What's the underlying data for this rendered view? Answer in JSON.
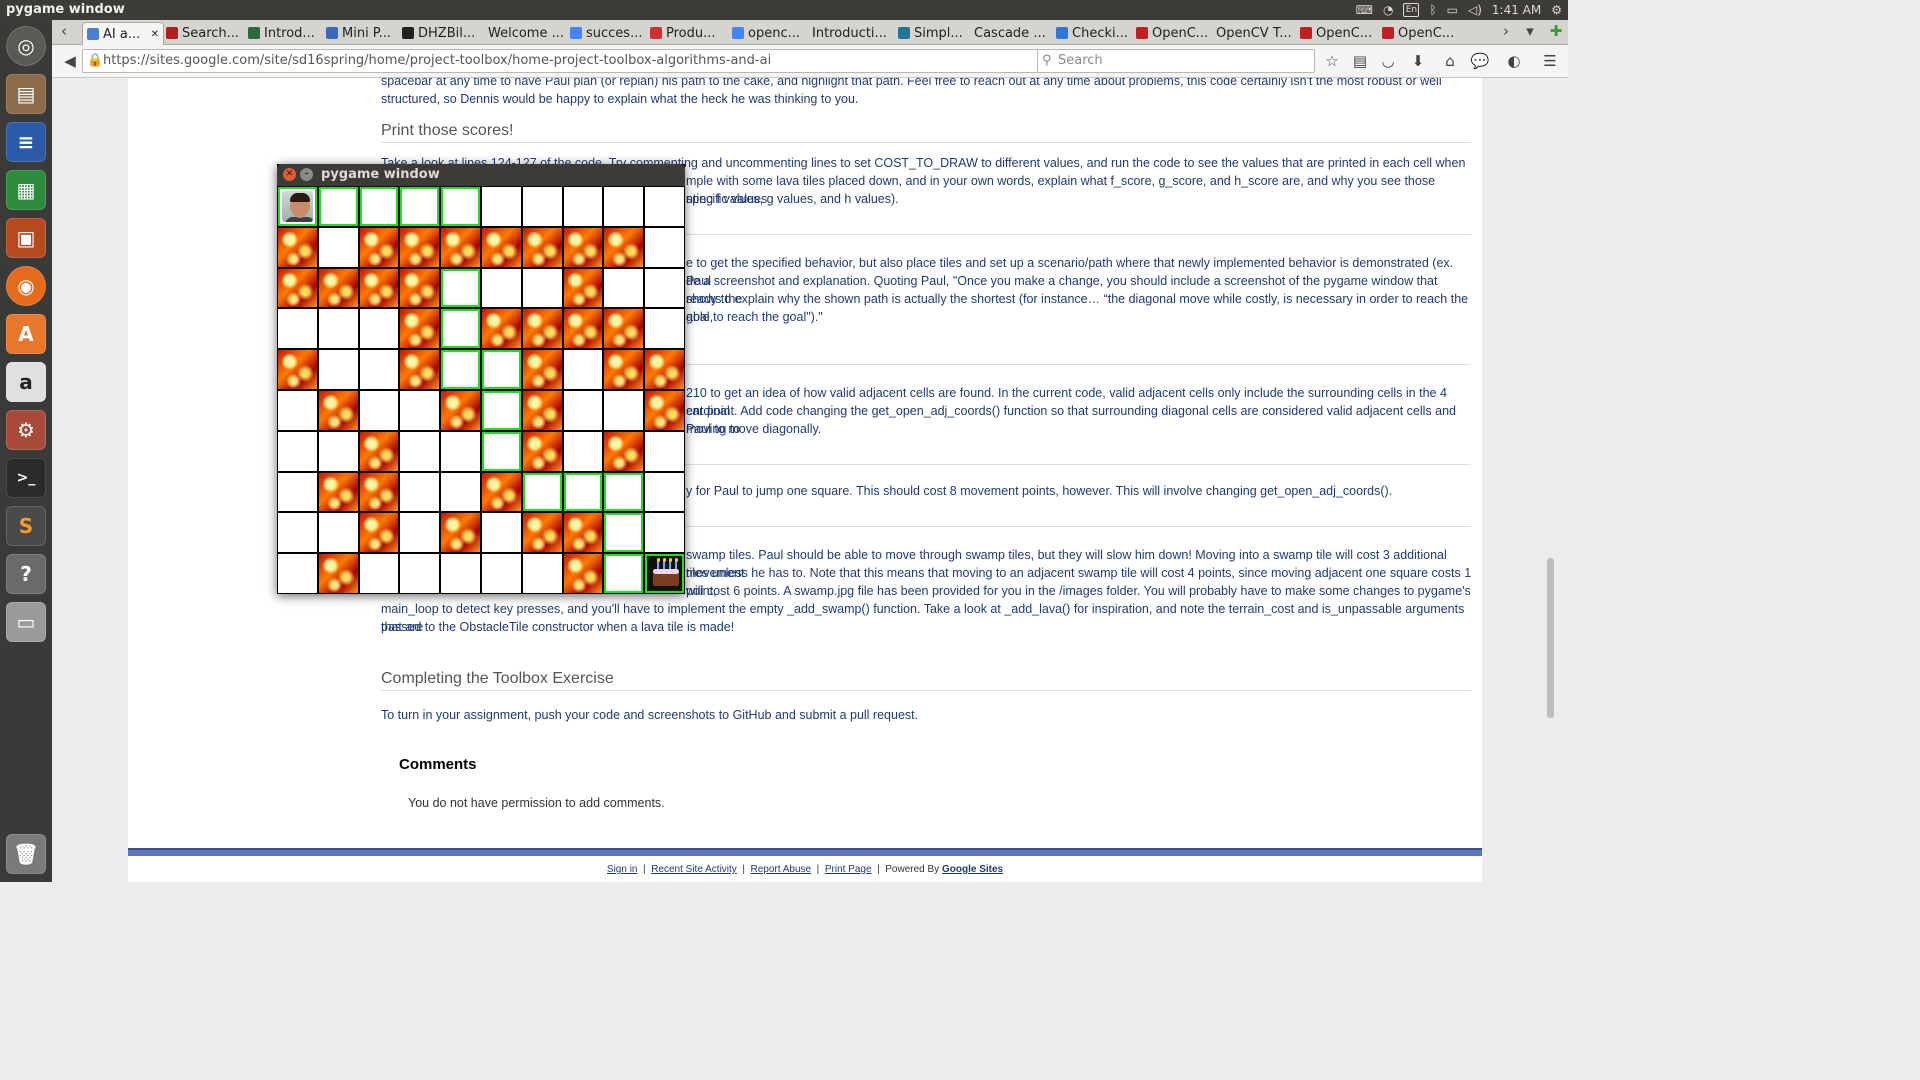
{
  "topbar": {
    "window_title": "pygame window",
    "keyboard_layout": "En",
    "time": "1:41 AM"
  },
  "launcher": {
    "items": [
      "ubuntu-dash",
      "files",
      "writer",
      "calc",
      "impress",
      "firefox",
      "software-center",
      "amazon",
      "system-settings",
      "terminal",
      "sublime-text",
      "help",
      "drive",
      "trash"
    ]
  },
  "tabs": [
    {
      "label": "AI a...",
      "active": true,
      "icon_color": "#4a7fd4"
    },
    {
      "label": "Search...",
      "icon_color": "#b02020"
    },
    {
      "label": "Introd...",
      "icon_color": "#2a6a3a"
    },
    {
      "label": "Mini P...",
      "icon_color": "#3a6ac0"
    },
    {
      "label": "DHZBil...",
      "icon_color": "#222222"
    },
    {
      "label": "Welcome ...",
      "icon_color": ""
    },
    {
      "label": "succes...",
      "icon_color": "#4285f4"
    },
    {
      "label": "Produ...",
      "icon_color": "#d03030"
    },
    {
      "label": "openc...",
      "icon_color": "#4285f4"
    },
    {
      "label": "Introducti...",
      "icon_color": ""
    },
    {
      "label": "Simpl...",
      "icon_color": "#21759b"
    },
    {
      "label": "Cascade ...",
      "icon_color": ""
    },
    {
      "label": "Checki...",
      "icon_color": "#2f76d6"
    },
    {
      "label": "OpenC...",
      "icon_color": "#c02020"
    },
    {
      "label": "OpenCV T...",
      "icon_color": ""
    },
    {
      "label": "OpenC...",
      "icon_color": "#c02020"
    },
    {
      "label": "OpenC...",
      "icon_color": "#c02020"
    }
  ],
  "navbar": {
    "url": "https://sites.google.com/site/sd16spring/home/project-toolbox/home-project-toolbox-algorithms-and-ai",
    "search_placeholder": "Search"
  },
  "page": {
    "intro_text": "spacebar at any time to have Paul plan (or replan) his path to the cake, and highlight that path. Feel free to reach out at any time about problems, this code certainly isn't the most robust or well structured, so Dennis would be happy to explain what the heck he was thinking to you.",
    "scores_heading": "Print those scores!",
    "scores_text_a": "Take a look at lines 124-127 of the code. Try commenting and uncommenting lines to set COST_TO_DRAW to different values, and run the code to see the values that are printed in each cell when you hit the",
    "scores_text_b": "mple with some lava tiles placed down, and in your own words, explain what f_score, g_score, and h_score are, and why you see those specific values",
    "scores_text_c": "nting f values, g values, and h values).",
    "behavior_text_a": "e to get the specified behavior, but also place tiles and set up a scenario/path where that newly implemented behavior is demonstrated (ex. Paul",
    "behavior_text_b": "de a screenshot and explanation. Quoting Paul, \"Once you make a change, you should include a screenshot of the pygame window that shows the",
    "behavior_text_c": "ready to explain why the shown path is actually the shortest (for instance… “the diagonal move while costly, is necessary in order to reach the goal,",
    "behavior_text_d": "able to reach the goal\").\"",
    "adjacent_text_a": "210 to get an idea of how valid adjacent cells are found. In the current code, valid adjacent cells only include the surrounding cells in the 4 cardinal",
    "adjacent_text_b": "ent point. Add code changing the get_open_adj_coords() function so that surrounding diagonal cells are considered valid adjacent cells and moving to",
    "adjacent_text_c": "Paul to move diagonally.",
    "jump_text": "y for Paul to jump one square. This should cost 8 movement points, however. This will involve changing get_open_adj_coords().",
    "swamp_text_a": "swamp tiles. Paul should be able to move through swamp tiles, but they will slow him down! Moving into a swamp tile will cost 3 additional movement",
    "swamp_text_b": "tiles unless he has to. Note that this means that moving to an adjacent swamp tile will cost 4 points, since moving adjacent one square costs 1 point,",
    "swamp_text_c": "will cost 6 points. A swamp.jpg file has been provided for you in the /images folder. You will probably have to make some changes to pygame's",
    "swamp_text_d": "main_loop to detect key presses, and you'll have to implement the empty _add_swamp() function. Take a look at _add_lava() for inspiration, and note the terrain_cost and is_unpassable arguments that are",
    "swamp_text_e": "passed to the ObstacleTile constructor when a lava tile is made!",
    "complete_heading": "Completing the Toolbox Exercise",
    "complete_text": "To turn in your assignment, push your code and screenshots to GitHub and submit a pull request.",
    "comments_heading": "Comments",
    "comments_text": "You do not have permission to add comments."
  },
  "footer": {
    "sign_in": "Sign in",
    "recent_activity": "Recent Site Activity",
    "report_abuse": "Report Abuse",
    "print_page": "Print Page",
    "powered_by": "Powered By",
    "google_sites": "Google Sites"
  },
  "pygame": {
    "title": "pygame window",
    "grid": [
      "APPPP.....",
      "L.LLLLLLL.",
      "LLLLP..L..",
      "...LPLLLL.",
      "L..LPPL.LL",
      ".L..LPL..L",
      "..L..PL.L.",
      ".LL..LPPP.",
      "..L.L.LLP.",
      ".L.....LPG"
    ],
    "legend": {
      "A": "paul",
      "L": "lava",
      "P": "path",
      "G": "cake",
      ".": "empty"
    }
  }
}
